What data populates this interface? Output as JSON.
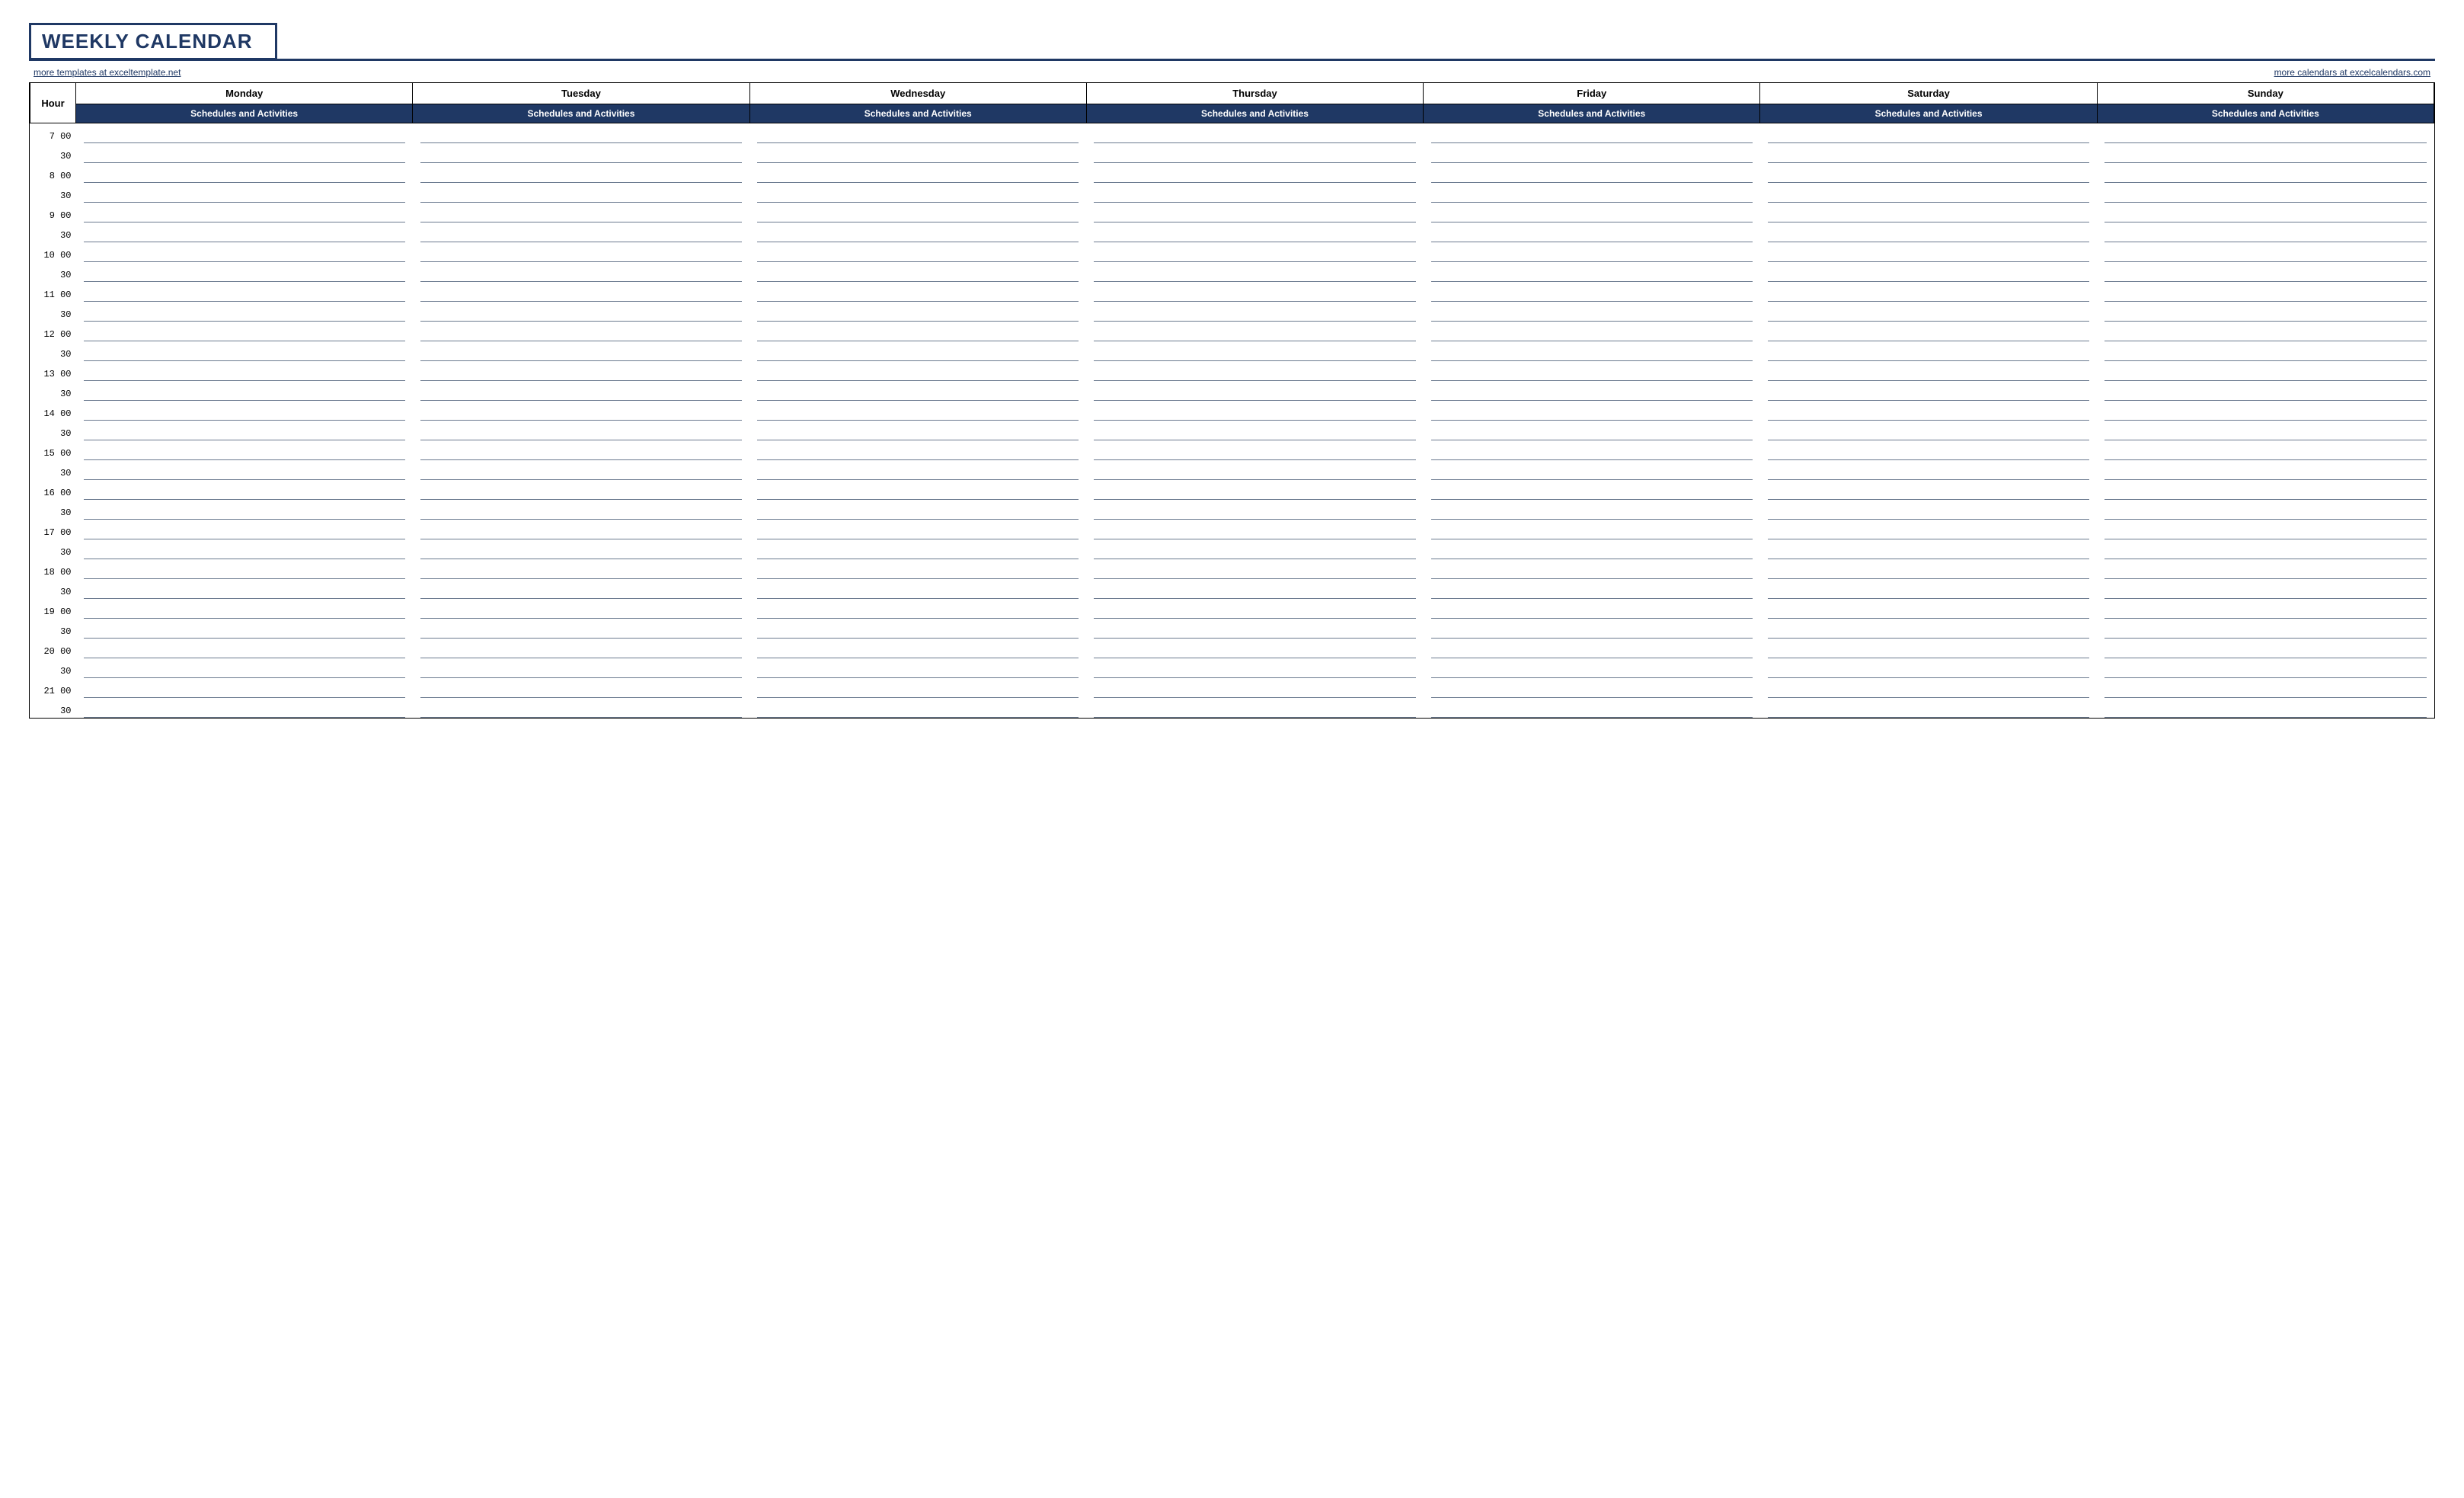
{
  "title": "WEEKLY CALENDAR",
  "link_left": "more templates at exceltemplate.net",
  "link_right": "more calendars at excelcalendars.com",
  "hour_label": "Hour",
  "subheader": "Schedules and Activities",
  "days": [
    "Monday",
    "Tuesday",
    "Wednesday",
    "Thursday",
    "Friday",
    "Saturday",
    "Sunday"
  ],
  "time_rows": [
    "7  00",
    "30",
    "8  00",
    "30",
    "9  00",
    "30",
    "10  00",
    "30",
    "11  00",
    "30",
    "12  00",
    "30",
    "13  00",
    "30",
    "14  00",
    "30",
    "15  00",
    "30",
    "16  00",
    "30",
    "17  00",
    "30",
    "18  00",
    "30",
    "19  00",
    "30",
    "20  00",
    "30",
    "21  00",
    "30"
  ],
  "colors": {
    "brand": "#1f3864",
    "rule": "#6b7a8f"
  }
}
